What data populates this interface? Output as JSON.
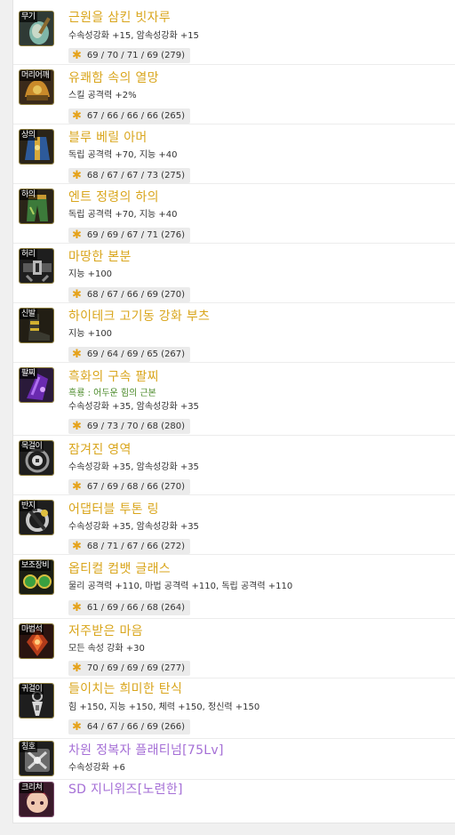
{
  "colors": {
    "legendary": "#d9a51b",
    "epic": "#a56fd6",
    "sub_text": "#4b8a2a",
    "star": "#e5a21a"
  },
  "items": [
    {
      "slot": "무기",
      "name": "근원을 삼킨 빗자루",
      "rarity": "legendary",
      "stats": "수속성강화 +15, 암속성강화 +15",
      "score": "69 / 70 / 71 / 69 (279)",
      "icon": "broom-icon"
    },
    {
      "slot": "머리어깨",
      "name": "유쾌함 속의 열망",
      "rarity": "legendary",
      "stats": "스킬 공격력 +2%",
      "score": "67 / 66 / 66 / 66 (265)",
      "icon": "shoulder-armor-icon"
    },
    {
      "slot": "상의",
      "name": "블루 베릴 아머",
      "rarity": "legendary",
      "stats": "독립 공격력 +70, 지능 +40",
      "score": "68 / 67 / 67 / 73 (275)",
      "icon": "top-armor-icon"
    },
    {
      "slot": "하의",
      "name": "엔트 정령의 하의",
      "rarity": "legendary",
      "stats": "독립 공격력 +70, 지능 +40",
      "score": "69 / 69 / 67 / 71 (276)",
      "icon": "pants-icon"
    },
    {
      "slot": "허리",
      "name": "마땅한 본분",
      "rarity": "legendary",
      "stats": "지능 +100",
      "score": "68 / 67 / 66 / 69 (270)",
      "icon": "belt-icon"
    },
    {
      "slot": "신발",
      "name": "하이테크 고기동 강화 부츠",
      "rarity": "legendary",
      "stats": "지능 +100",
      "score": "69 / 64 / 69 / 65 (267)",
      "icon": "boots-icon"
    },
    {
      "slot": "팔찌",
      "name": "흑화의 구속 팔찌",
      "rarity": "legendary",
      "sub": "흑룡 : 어두운 힘의 근본",
      "stats": "수속성강화 +35, 암속성강화 +35",
      "score": "69 / 73 / 70 / 68 (280)",
      "icon": "bracelet-icon"
    },
    {
      "slot": "목걸이",
      "name": "잠겨진 영역",
      "rarity": "legendary",
      "stats": "수속성강화 +35, 암속성강화 +35",
      "score": "67 / 69 / 68 / 66 (270)",
      "icon": "necklace-icon"
    },
    {
      "slot": "반지",
      "name": "어댑터블 투톤 링",
      "rarity": "legendary",
      "stats": "수속성강화 +35, 암속성강화 +35",
      "score": "68 / 71 / 67 / 66 (272)",
      "icon": "ring-icon"
    },
    {
      "slot": "보조장비",
      "name": "옵티컬 컴뱃 글래스",
      "rarity": "legendary",
      "stats": "물리 공격력 +110, 마법 공격력 +110, 독립 공격력 +110",
      "score": "61 / 69 / 66 / 68 (264)",
      "icon": "glasses-icon"
    },
    {
      "slot": "마법석",
      "name": "저주받은 마음",
      "rarity": "legendary",
      "stats": "모든 속성 강화 +30",
      "score": "70 / 69 / 69 / 69 (277)",
      "icon": "magic-stone-icon"
    },
    {
      "slot": "귀걸이",
      "name": "들이치는 희미한 탄식",
      "rarity": "legendary",
      "stats": "힘 +150, 지능 +150, 체력 +150, 정신력 +150",
      "score": "64 / 67 / 66 / 69 (266)",
      "icon": "earring-icon"
    },
    {
      "slot": "칭호",
      "name": "차원 정복자 플래티넘[75Lv]",
      "rarity": "epic",
      "stats": "수속성강화 +6",
      "icon": "title-icon"
    },
    {
      "slot": "크리쳐",
      "name": "SD 지니위즈[노련한]",
      "rarity": "epic",
      "icon": "creature-icon"
    }
  ]
}
